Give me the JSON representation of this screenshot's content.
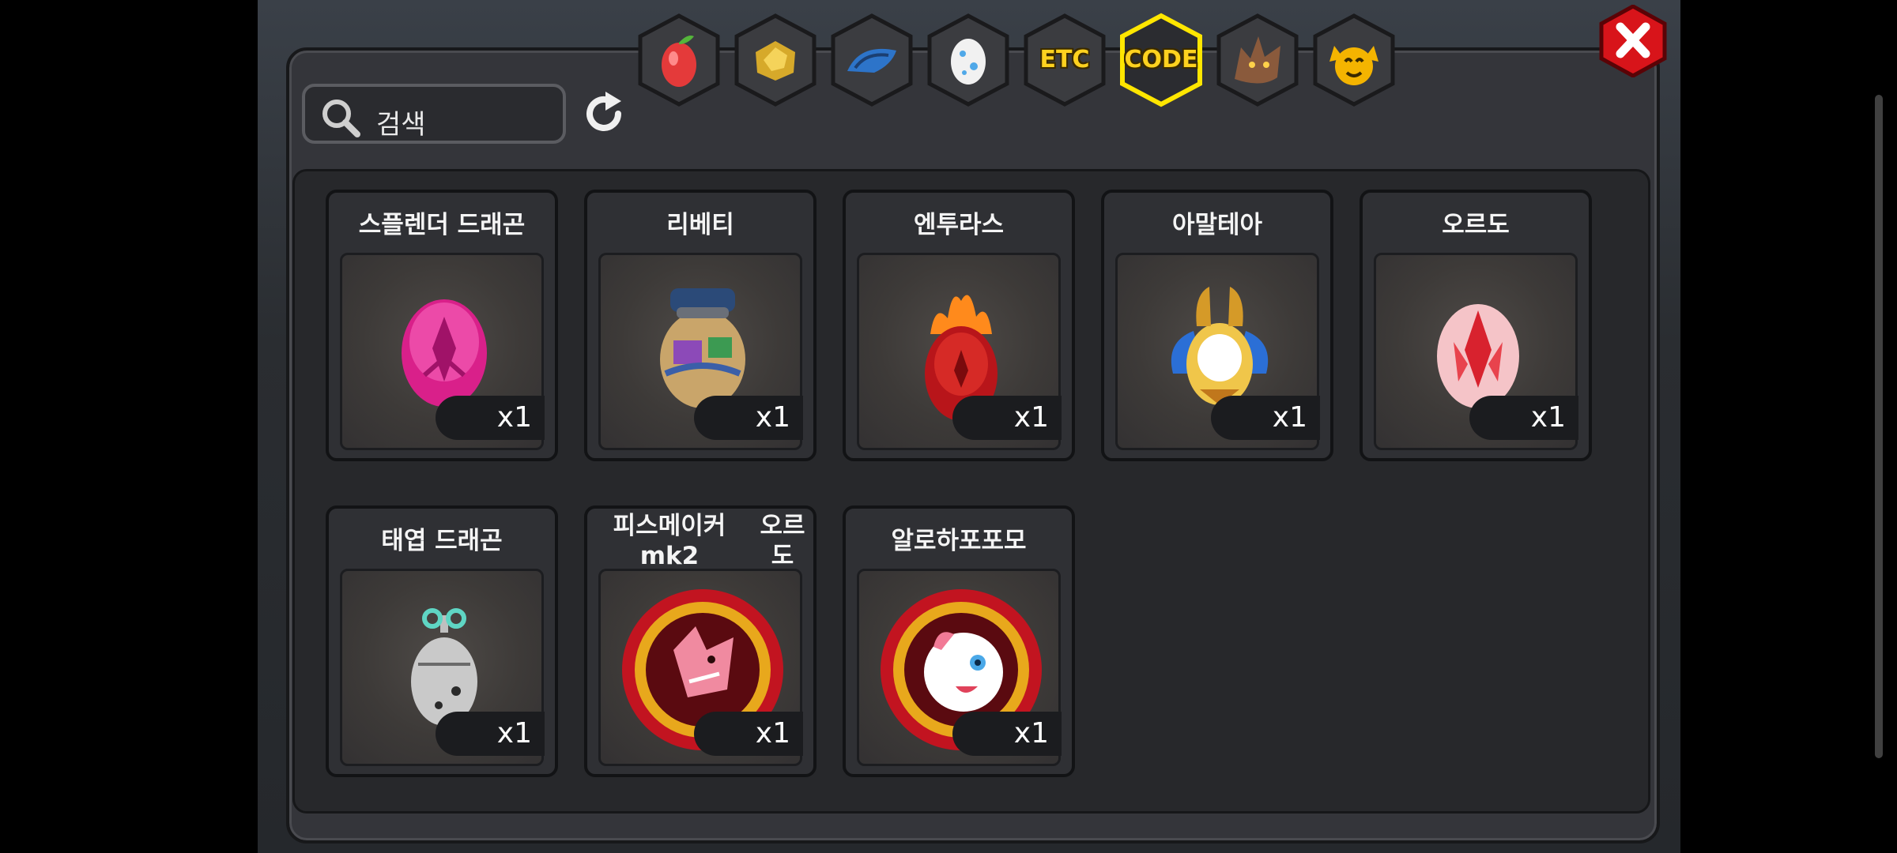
{
  "search": {
    "placeholder": "검색"
  },
  "tabs": [
    {
      "id": "fruit",
      "icon": "fruit-icon",
      "label": ""
    },
    {
      "id": "gold",
      "icon": "gold-nugget-icon",
      "label": ""
    },
    {
      "id": "scale",
      "icon": "dragon-scale-icon",
      "label": ""
    },
    {
      "id": "egg",
      "icon": "egg-icon",
      "label": ""
    },
    {
      "id": "etc",
      "icon": "",
      "label": "ETC"
    },
    {
      "id": "code",
      "icon": "",
      "label": "CODE",
      "active": true
    },
    {
      "id": "dragon",
      "icon": "dragon-head-icon",
      "label": ""
    },
    {
      "id": "pet",
      "icon": "pet-face-icon",
      "label": ""
    }
  ],
  "items": [
    {
      "name": "스플렌더 드래곤",
      "qty": "x1",
      "icon": "pink-egg-icon"
    },
    {
      "name": "리베티",
      "qty": "x1",
      "icon": "sack-egg-icon"
    },
    {
      "name": "엔투라스",
      "qty": "x1",
      "icon": "fire-egg-icon"
    },
    {
      "name": "아말테아",
      "qty": "x1",
      "icon": "winged-egg-icon"
    },
    {
      "name": "오르도",
      "qty": "x1",
      "icon": "crystal-egg-icon"
    },
    {
      "name": "태엽 드래곤",
      "qty": "x1",
      "icon": "windup-egg-icon"
    },
    {
      "name_line1": "피스메이커 mk2",
      "name_line2": "오르도",
      "qty": "x1",
      "icon": "dragon-medal-icon"
    },
    {
      "name_line1": "알로하",
      "name_line2": "포포모",
      "qty": "x1",
      "icon": "pet-medal-icon"
    }
  ],
  "colors": {
    "accent": "#ffd21f",
    "close": "#d8141a"
  }
}
